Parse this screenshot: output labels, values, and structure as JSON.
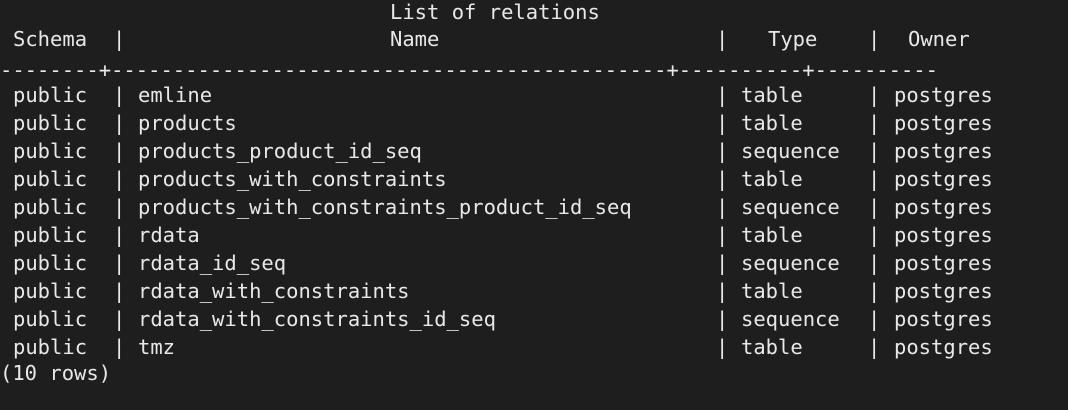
{
  "table": {
    "title": "List of relations",
    "headers": {
      "schema": "Schema",
      "name": "Name",
      "type": "Type",
      "owner": "Owner"
    },
    "separator": "--------+---------------------------------------------+----------+----------",
    "pipe": "|",
    "rows": [
      {
        "schema": "public",
        "name": "emline",
        "type": "table",
        "owner": "postgres"
      },
      {
        "schema": "public",
        "name": "products",
        "type": "table",
        "owner": "postgres"
      },
      {
        "schema": "public",
        "name": "products_product_id_seq",
        "type": "sequence",
        "owner": "postgres"
      },
      {
        "schema": "public",
        "name": "products_with_constraints",
        "type": "table",
        "owner": "postgres"
      },
      {
        "schema": "public",
        "name": "products_with_constraints_product_id_seq",
        "type": "sequence",
        "owner": "postgres"
      },
      {
        "schema": "public",
        "name": "rdata",
        "type": "table",
        "owner": "postgres"
      },
      {
        "schema": "public",
        "name": "rdata_id_seq",
        "type": "sequence",
        "owner": "postgres"
      },
      {
        "schema": "public",
        "name": "rdata_with_constraints",
        "type": "table",
        "owner": "postgres"
      },
      {
        "schema": "public",
        "name": "rdata_with_constraints_id_seq",
        "type": "sequence",
        "owner": "postgres"
      },
      {
        "schema": "public",
        "name": "tmz",
        "type": "table",
        "owner": "postgres"
      }
    ],
    "footer": "(10 rows)"
  },
  "colors": {
    "background": "#1e1e1e",
    "text": "#e8e8e8"
  }
}
